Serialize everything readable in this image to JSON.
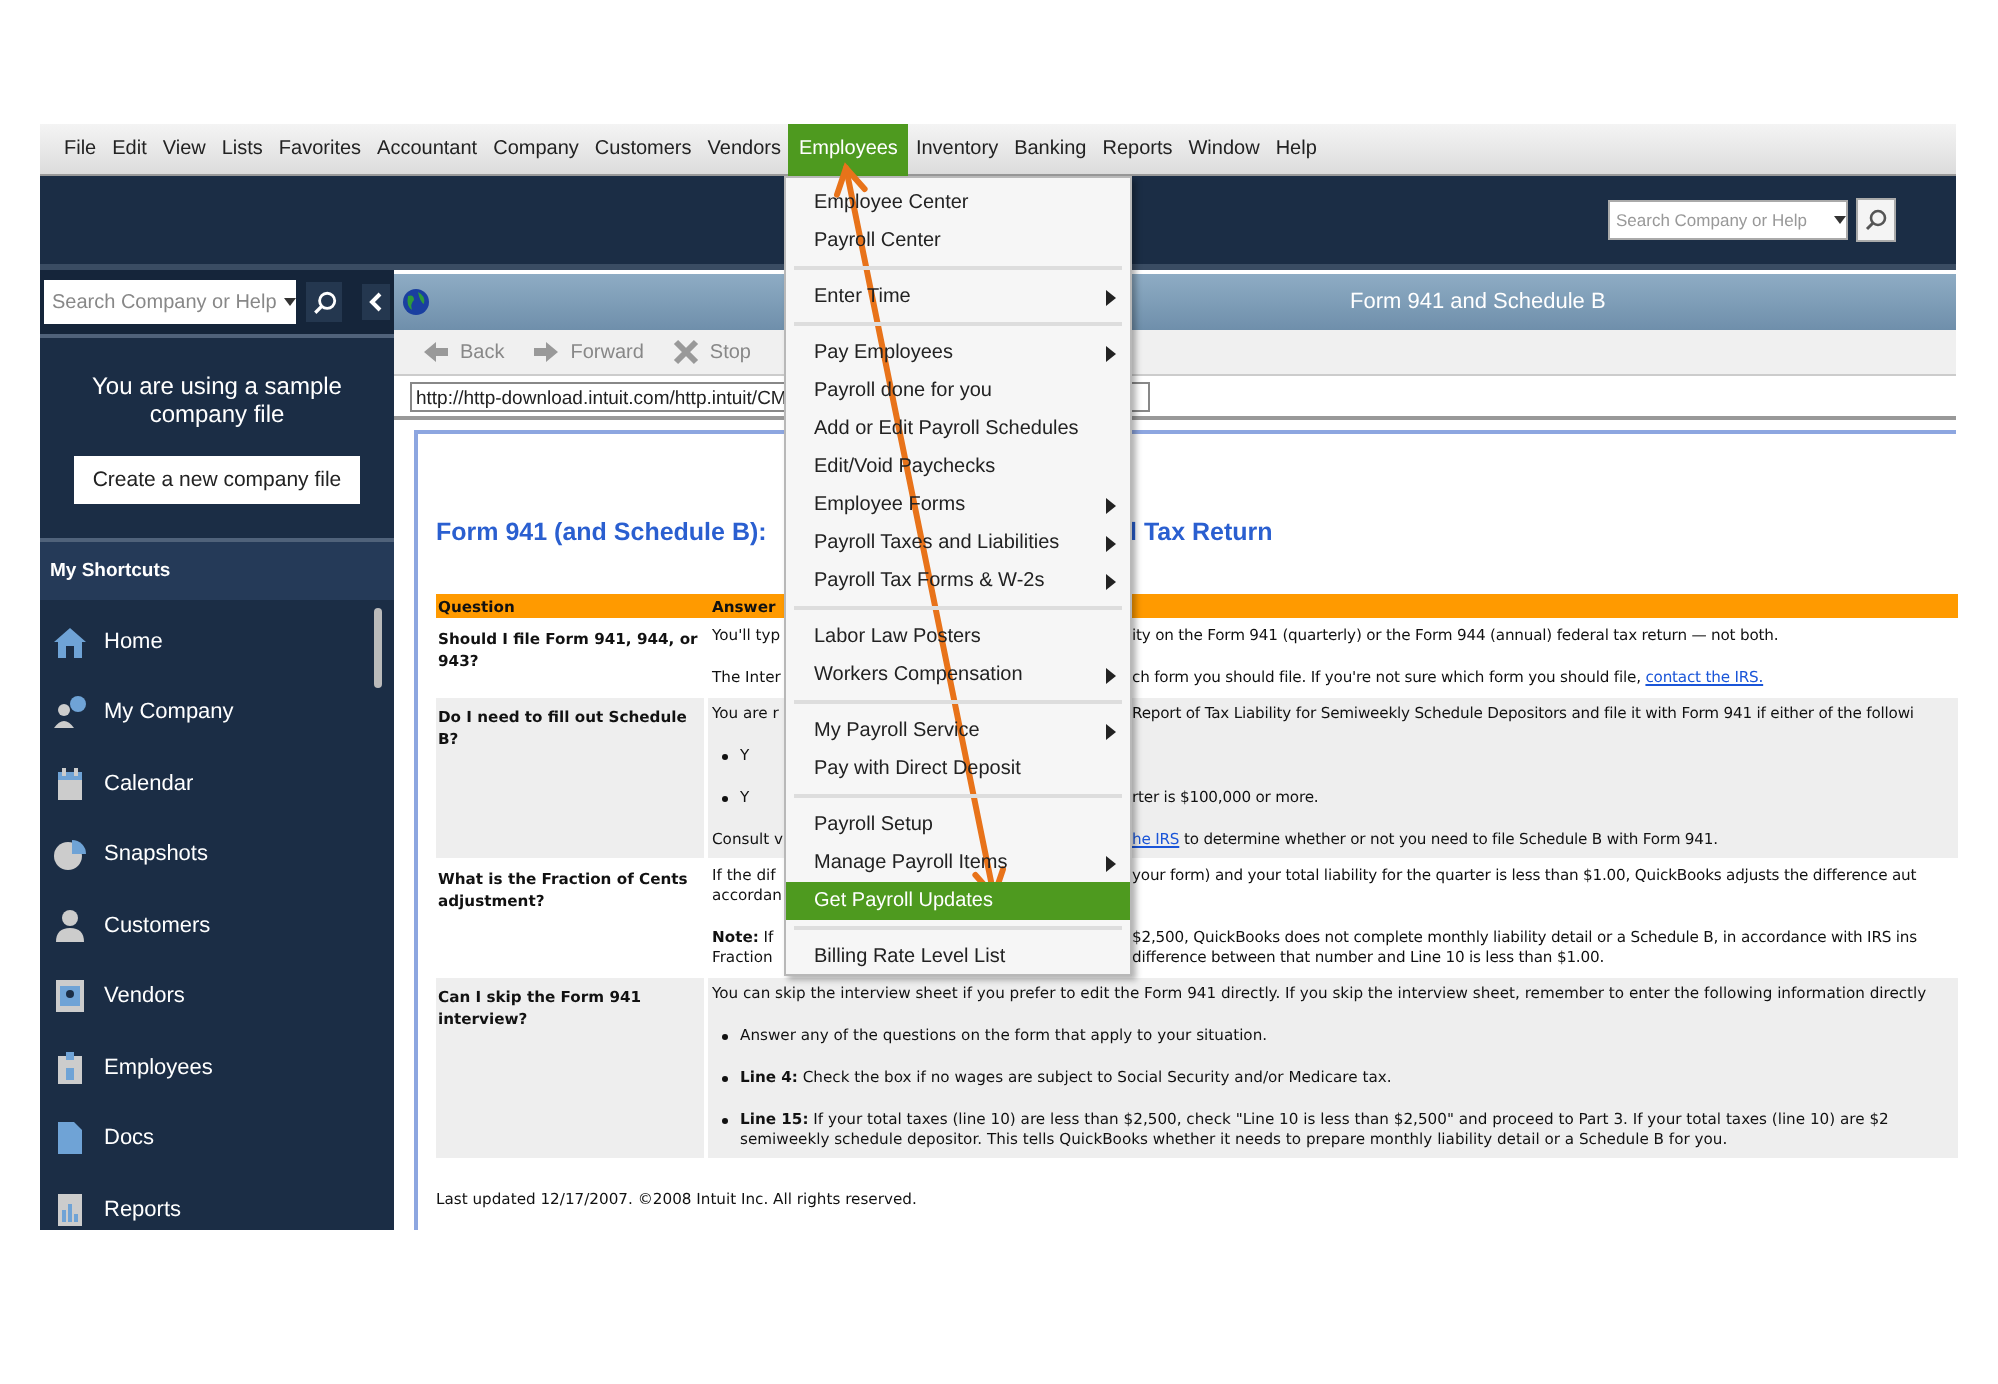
{
  "menu_bar": [
    {
      "label": "File",
      "selected": false
    },
    {
      "label": "Edit",
      "selected": false
    },
    {
      "label": "View",
      "selected": false
    },
    {
      "label": "Lists",
      "selected": false
    },
    {
      "label": "Favorites",
      "selected": false
    },
    {
      "label": "Accountant",
      "selected": false
    },
    {
      "label": "Company",
      "selected": false
    },
    {
      "label": "Customers",
      "selected": false
    },
    {
      "label": "Vendors",
      "selected": false
    },
    {
      "label": "Employees",
      "selected": true
    },
    {
      "label": "Inventory",
      "selected": false
    },
    {
      "label": "Banking",
      "selected": false
    },
    {
      "label": "Reports",
      "selected": false
    },
    {
      "label": "Window",
      "selected": false
    },
    {
      "label": "Help",
      "selected": false
    }
  ],
  "top_search": {
    "placeholder": "Search Company or Help"
  },
  "sidebar": {
    "search": {
      "placeholder": "Search Company or Help"
    },
    "notice": "You are using a sample company file",
    "create_button": "Create a new company file",
    "shortcuts_title": "My Shortcuts",
    "items": [
      {
        "label": "Home",
        "kind": "home"
      },
      {
        "label": "My Company",
        "kind": "company"
      },
      {
        "label": "Calendar",
        "kind": "calendar"
      },
      {
        "label": "Snapshots",
        "kind": "snapshots"
      },
      {
        "label": "Customers",
        "kind": "customers"
      },
      {
        "label": "Vendors",
        "kind": "vendors"
      },
      {
        "label": "Employees",
        "kind": "employees"
      },
      {
        "label": "Docs",
        "kind": "docs"
      },
      {
        "label": "Reports",
        "kind": "reports"
      }
    ]
  },
  "window": {
    "title": "Form 941 and Schedule B",
    "toolbar": [
      {
        "label": "Back",
        "kind": "back"
      },
      {
        "label": "Forward",
        "kind": "forward"
      },
      {
        "label": "Stop",
        "kind": "stop"
      }
    ],
    "url": "http://http-download.intuit.com/http.intuit/CM"
  },
  "page": {
    "heading_left": "Form 941 (and Schedule B):",
    "heading_right": "l Tax Return",
    "columns": [
      "Question",
      "Answer"
    ],
    "rows": [
      {
        "question": "Should I file Form 941, 944, or 943?",
        "covered": true,
        "shaded": false,
        "paragraphs": [
          {
            "kind": "text",
            "lines": [
              {
                "left": "You'll typ",
                "right": "ity on the Form 941 (quarterly) or the Form 944 (annual) federal tax return — not both."
              }
            ]
          },
          {
            "kind": "text",
            "lines": [
              {
                "left": "The Inter",
                "right": "ch form you should file. If you're not sure which form you should file, ",
                "link_after": "contact the IRS."
              }
            ]
          }
        ]
      },
      {
        "question": "Do I need to fill out Schedule B?",
        "covered": true,
        "shaded": true,
        "paragraphs": [
          {
            "kind": "text",
            "lines": [
              {
                "left": "You are r",
                "right": "Report of Tax Liability for Semiweekly Schedule Depositors and file it with Form 941 if either of the followi"
              }
            ]
          },
          {
            "kind": "bullet",
            "lines": [
              {
                "left": "Y"
              }
            ]
          },
          {
            "kind": "bullet",
            "lines": [
              {
                "left": "Y",
                "right": "rter is $100,000 or more."
              }
            ]
          },
          {
            "kind": "text",
            "lines": [
              {
                "left": "Consult v",
                "link_before": "he IRS",
                "right": " to determine whether or not you need to file Schedule B with Form 941."
              }
            ]
          }
        ]
      },
      {
        "question": "What is the Fraction of Cents adjustment?",
        "covered": true,
        "shaded": false,
        "paragraphs": [
          {
            "kind": "text",
            "lines": [
              {
                "left": "If the dif",
                "right": "your form) and your total liability for the quarter is less than $1.00, QuickBooks adjusts the difference aut"
              },
              {
                "left": "accordan"
              }
            ]
          },
          {
            "kind": "text",
            "lines": [
              {
                "left": "**Note:** If",
                "right": "$2,500, QuickBooks does not complete monthly liability detail or a Schedule B, in accordance with IRS ins"
              },
              {
                "left": "Fraction",
                "right": "difference between that number and Line 10 is less than $1.00."
              }
            ]
          }
        ]
      },
      {
        "question": "Can I skip the Form 941 interview?",
        "covered": false,
        "shaded": true,
        "paragraphs": [
          {
            "kind": "text",
            "lines": [
              {
                "left": "You can skip the interview sheet if you prefer to edit the Form 941 directly. If you skip the interview sheet, remember to enter the following information directly"
              }
            ]
          },
          {
            "kind": "bullet",
            "lines": [
              {
                "left": "Answer any of the questions on the form that apply to your situation."
              }
            ]
          },
          {
            "kind": "bullet",
            "lines": [
              {
                "left": "**Line 4:** Check the box if no wages are subject to Social Security and/or Medicare tax."
              }
            ]
          },
          {
            "kind": "bullet",
            "lines": [
              {
                "left": "**Line 15:** If your total taxes (line 10) are less than $2,500, check \"Line 10 is less than $2,500\" and proceed to Part 3. If your total taxes (line 10) are $2\nsemiweekly schedule depositor. This tells QuickBooks whether it needs to prepare monthly liability detail or a Schedule B for you."
              }
            ]
          }
        ]
      }
    ],
    "footer": "Last updated 12/17/2007. ©2008 Intuit Inc. All rights reserved."
  },
  "dropdown": {
    "groups": [
      {
        "items": [
          {
            "label": "Employee Center",
            "submenu": false,
            "selected": false
          },
          {
            "label": "Payroll Center",
            "submenu": false,
            "selected": false
          }
        ]
      },
      {
        "items": [
          {
            "label": "Enter Time",
            "submenu": true,
            "selected": false
          }
        ]
      },
      {
        "items": [
          {
            "label": "Pay Employees",
            "submenu": true,
            "selected": false
          },
          {
            "label": "Payroll done for you",
            "submenu": false,
            "selected": false
          },
          {
            "label": "Add or Edit Payroll Schedules",
            "submenu": false,
            "selected": false
          },
          {
            "label": "Edit/Void Paychecks",
            "submenu": false,
            "selected": false
          },
          {
            "label": "Employee Forms",
            "submenu": true,
            "selected": false
          },
          {
            "label": "Payroll Taxes and Liabilities",
            "submenu": true,
            "selected": false
          },
          {
            "label": "Payroll Tax Forms & W-2s",
            "submenu": true,
            "selected": false
          }
        ]
      },
      {
        "items": [
          {
            "label": "Labor Law Posters",
            "submenu": false,
            "selected": false
          },
          {
            "label": "Workers Compensation",
            "submenu": true,
            "selected": false
          }
        ]
      },
      {
        "items": [
          {
            "label": "My Payroll Service",
            "submenu": true,
            "selected": false
          },
          {
            "label": "Pay with Direct Deposit",
            "submenu": false,
            "selected": false
          }
        ]
      },
      {
        "items": [
          {
            "label": "Payroll Setup",
            "submenu": false,
            "selected": false
          },
          {
            "label": "Manage Payroll Items",
            "submenu": true,
            "selected": false
          },
          {
            "label": "Get Payroll Updates",
            "submenu": false,
            "selected": true
          }
        ]
      },
      {
        "items": [
          {
            "label": "Billing Rate Level List",
            "submenu": false,
            "selected": false
          }
        ]
      }
    ]
  }
}
